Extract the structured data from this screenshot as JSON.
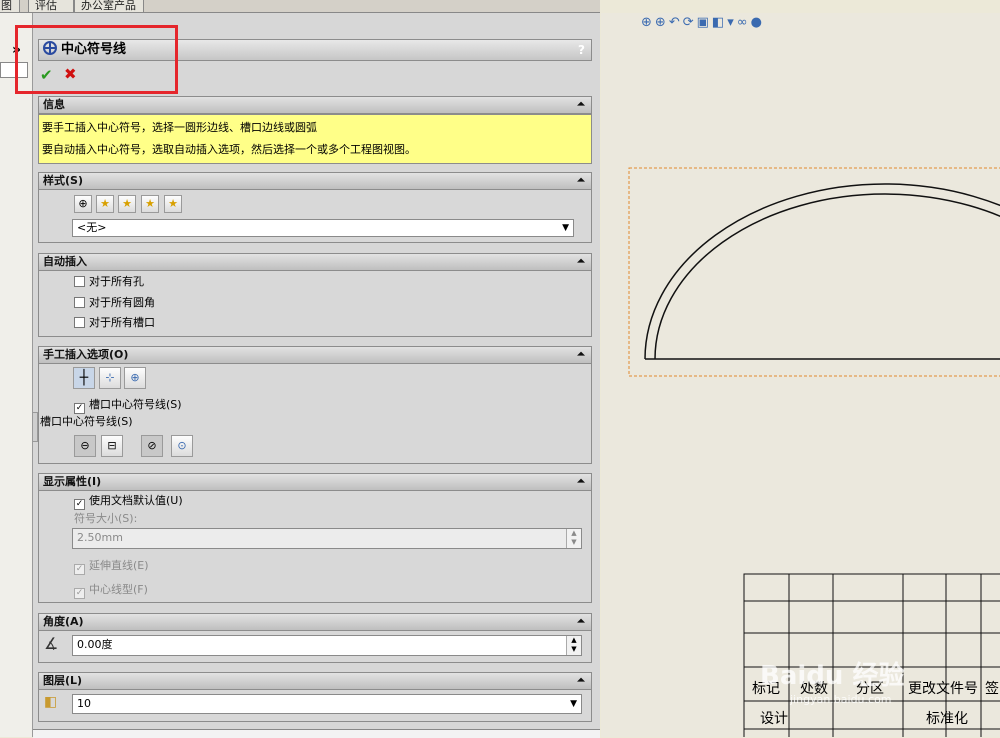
{
  "tabs": [
    {
      "label": "图"
    },
    {
      "label": "评估"
    },
    {
      "label": "办公室产品"
    }
  ],
  "expander_label": "»",
  "title": "中心符号线",
  "help_label": "?",
  "ok_label": "✔",
  "cancel_label": "✖",
  "sections": {
    "info": {
      "header": "信息",
      "line1": "要手工插入中心符号，选择一圆形边线、槽口边线或圆弧",
      "line2": "要自动插入中心符号，选取自动插入选项，然后选择一个或多个工程图视图。"
    },
    "style": {
      "header": "样式(S)",
      "dropdown_value": "<无>"
    },
    "auto_insert": {
      "header": "自动插入",
      "options": [
        "对于所有孔",
        "对于所有圆角",
        "对于所有槽口"
      ]
    },
    "manual": {
      "header": "手工插入选项(O)",
      "slot_checkbox": "槽口中心符号线(S)",
      "slot_label": "槽口中心符号线(S)"
    },
    "display": {
      "header": "显示属性(I)",
      "use_default": "使用文档默认值(U)",
      "size_label": "符号大小(S):",
      "size_value": "2.50mm",
      "extended": "延伸直线(E)",
      "centerline_font": "中心线型(F)"
    },
    "angle": {
      "header": "角度(A)",
      "value": "0.00度"
    },
    "layer": {
      "header": "图层(L)",
      "value": "10"
    }
  },
  "title_block": {
    "row1": [
      "标记",
      "处数",
      "分区",
      "更改文件号",
      "签"
    ],
    "design": "设计",
    "standardize": "标准化"
  },
  "watermark": "Baidu 经验",
  "watermark_url": "jingyan.baidu.com"
}
